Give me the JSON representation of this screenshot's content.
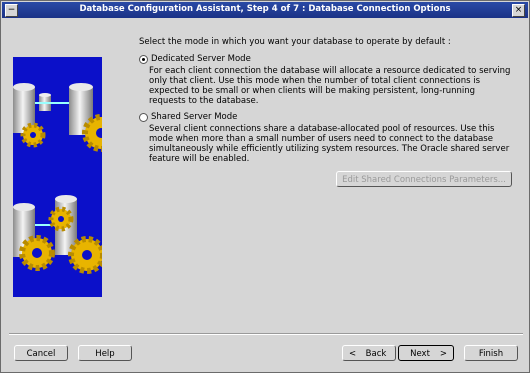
{
  "window": {
    "title": "Database Configuration Assistant, Step 4 of 7 : Database Connection Options"
  },
  "content": {
    "prompt": "Select the mode in which you want your database to operate by default :",
    "dedicated": {
      "label": "Dedicated Server Mode",
      "selected": true,
      "description": "For each client connection the database will allocate a resource dedicated to serving only that client.  Use this mode when the number of total client connections is expected to be small or when clients will be making persistent, long-running requests to the database."
    },
    "shared": {
      "label": "Shared Server Mode",
      "selected": false,
      "description": "Several client connections share a database-allocated pool of resources.  Use this mode when more than a small number of users need to connect to the database simultaneously while efficiently utilizing system resources.  The Oracle shared server feature will be enabled."
    },
    "edit_shared_button": "Edit Shared Connections Parameters..."
  },
  "footer": {
    "cancel": "Cancel",
    "help": "Help",
    "back": "Back",
    "next": "Next",
    "finish": "Finish"
  },
  "colors": {
    "titlebar": "#1f3a96",
    "graphic_bg": "#0b10c9",
    "gear": "#e8b400"
  }
}
